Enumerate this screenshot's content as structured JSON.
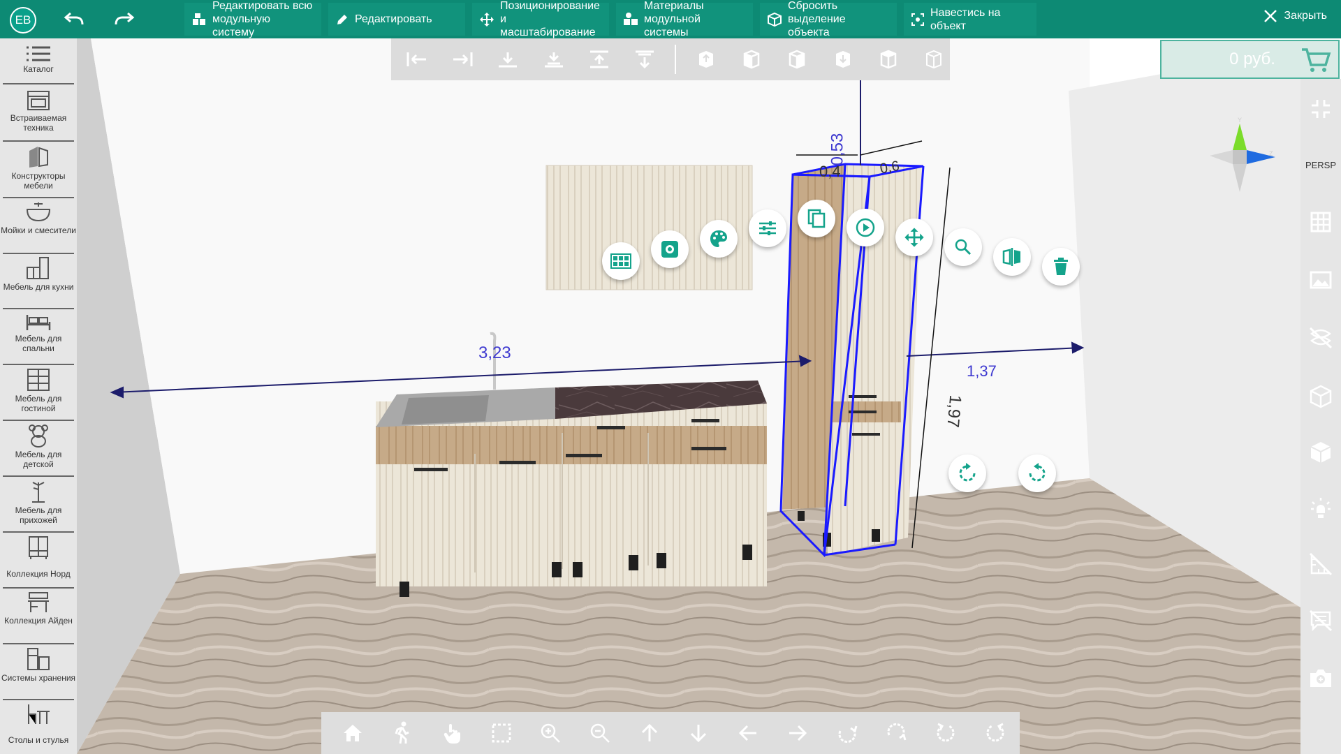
{
  "app": {
    "user_initials": "ЕВ",
    "price": "0 руб.",
    "view_mode": "PERSP",
    "close_label": "Закрыть"
  },
  "toolbar": {
    "buttons": [
      {
        "label": "Редактировать всю модульную систему",
        "icon": "modular-system-edit-icon"
      },
      {
        "label": "Редактировать",
        "icon": "pencil-icon"
      },
      {
        "label": "Позиционирование и масштабирование",
        "icon": "move-icon"
      },
      {
        "label": "Материалы модульной системы",
        "icon": "materials-icon"
      },
      {
        "label": "Сбросить выделение объекта",
        "icon": "cube-outline-icon"
      },
      {
        "label": "Навестись на объект",
        "icon": "focus-icon"
      }
    ]
  },
  "sidebar": {
    "items": [
      {
        "label": "Каталог",
        "icon": "list-icon"
      },
      {
        "label": "Встраиваемая техника",
        "icon": "oven-icon"
      },
      {
        "label": "Конструкторы мебели",
        "icon": "furniture-builder-icon"
      },
      {
        "label": "Мойки и смесители",
        "icon": "sink-icon"
      },
      {
        "label": "Мебель для кухни",
        "icon": "kitchen-furniture-icon"
      },
      {
        "label": "Мебель для спальни",
        "icon": "bed-icon"
      },
      {
        "label": "Мебель для гостиной",
        "icon": "shelving-icon"
      },
      {
        "label": "Мебель для детской",
        "icon": "teddy-bear-icon"
      },
      {
        "label": "Мебель для прихожей",
        "icon": "coat-rack-icon"
      },
      {
        "label": "Коллекция Норд",
        "icon": "cabinet-icon"
      },
      {
        "label": "Коллекция Айден",
        "icon": "desk-icon"
      },
      {
        "label": "Системы хранения",
        "icon": "storage-icon"
      },
      {
        "label": "Столы и стулья",
        "icon": "table-chair-icon"
      }
    ]
  },
  "dimensions": {
    "wall_length": "3,23",
    "height_top": "0,53",
    "depth": "0,4",
    "width": "0,6",
    "distance": "1,37",
    "height": "1,97"
  },
  "colors": {
    "accent": "#0d8a74",
    "fab_icon": "#14a38b",
    "dimension_blue": "#3f3ad0",
    "selection_blue": "#1a1aff"
  }
}
